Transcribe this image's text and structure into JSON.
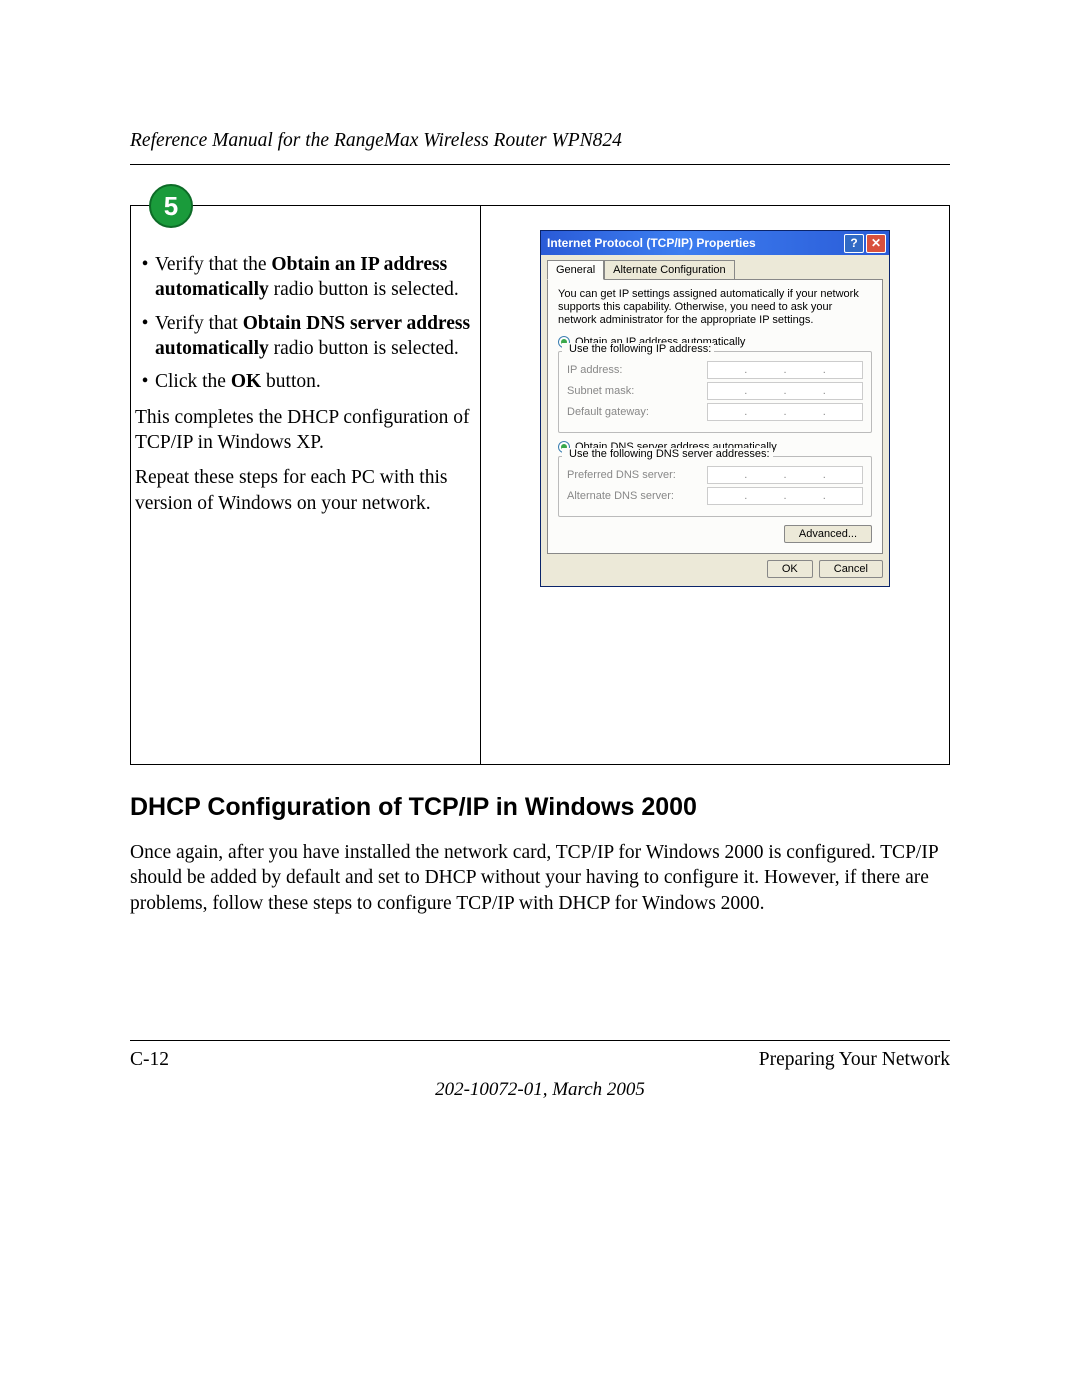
{
  "header": {
    "title": "Reference Manual for the RangeMax Wireless Router WPN824"
  },
  "step": {
    "number": "5",
    "bullets": [
      {
        "pre": "Verify that the ",
        "bold": "Obtain an IP address automatically",
        "post": " radio button is selected."
      },
      {
        "pre": "Verify that ",
        "bold": "Obtain DNS server address automatically",
        "post": " radio button is selected."
      },
      {
        "pre": "Click the ",
        "bold": "OK",
        "post": " button."
      }
    ],
    "para1": "This completes the DHCP configuration of TCP/IP in Windows XP.",
    "para2": "Repeat these steps for each PC with this version of Windows on your network."
  },
  "dialog": {
    "title": "Internet Protocol (TCP/IP) Properties",
    "tabs": {
      "general": "General",
      "alt": "Alternate Configuration"
    },
    "desc": "You can get IP settings assigned automatically if your network supports this capability. Otherwise, you need to ask your network administrator for the appropriate IP settings.",
    "radio_ip_auto": "Obtain an IP address automatically",
    "radio_ip_manual": "Use the following IP address:",
    "ip_address": "IP address:",
    "subnet": "Subnet mask:",
    "gateway": "Default gateway:",
    "radio_dns_auto": "Obtain DNS server address automatically",
    "radio_dns_manual": "Use the following DNS server addresses:",
    "preferred_dns": "Preferred DNS server:",
    "alternate_dns": "Alternate DNS server:",
    "advanced": "Advanced...",
    "ok": "OK",
    "cancel": "Cancel"
  },
  "section": {
    "heading": "DHCP Configuration of TCP/IP in Windows 2000",
    "body": "Once again, after you have installed the network card, TCP/IP for Windows 2000 is configured. TCP/IP should be added by default and set to DHCP without your having to configure it. However, if there are problems, follow these steps to configure TCP/IP with DHCP for Windows 2000."
  },
  "footer": {
    "page": "C-12",
    "right": "Preparing Your Network",
    "center": "202-10072-01, March 2005"
  }
}
